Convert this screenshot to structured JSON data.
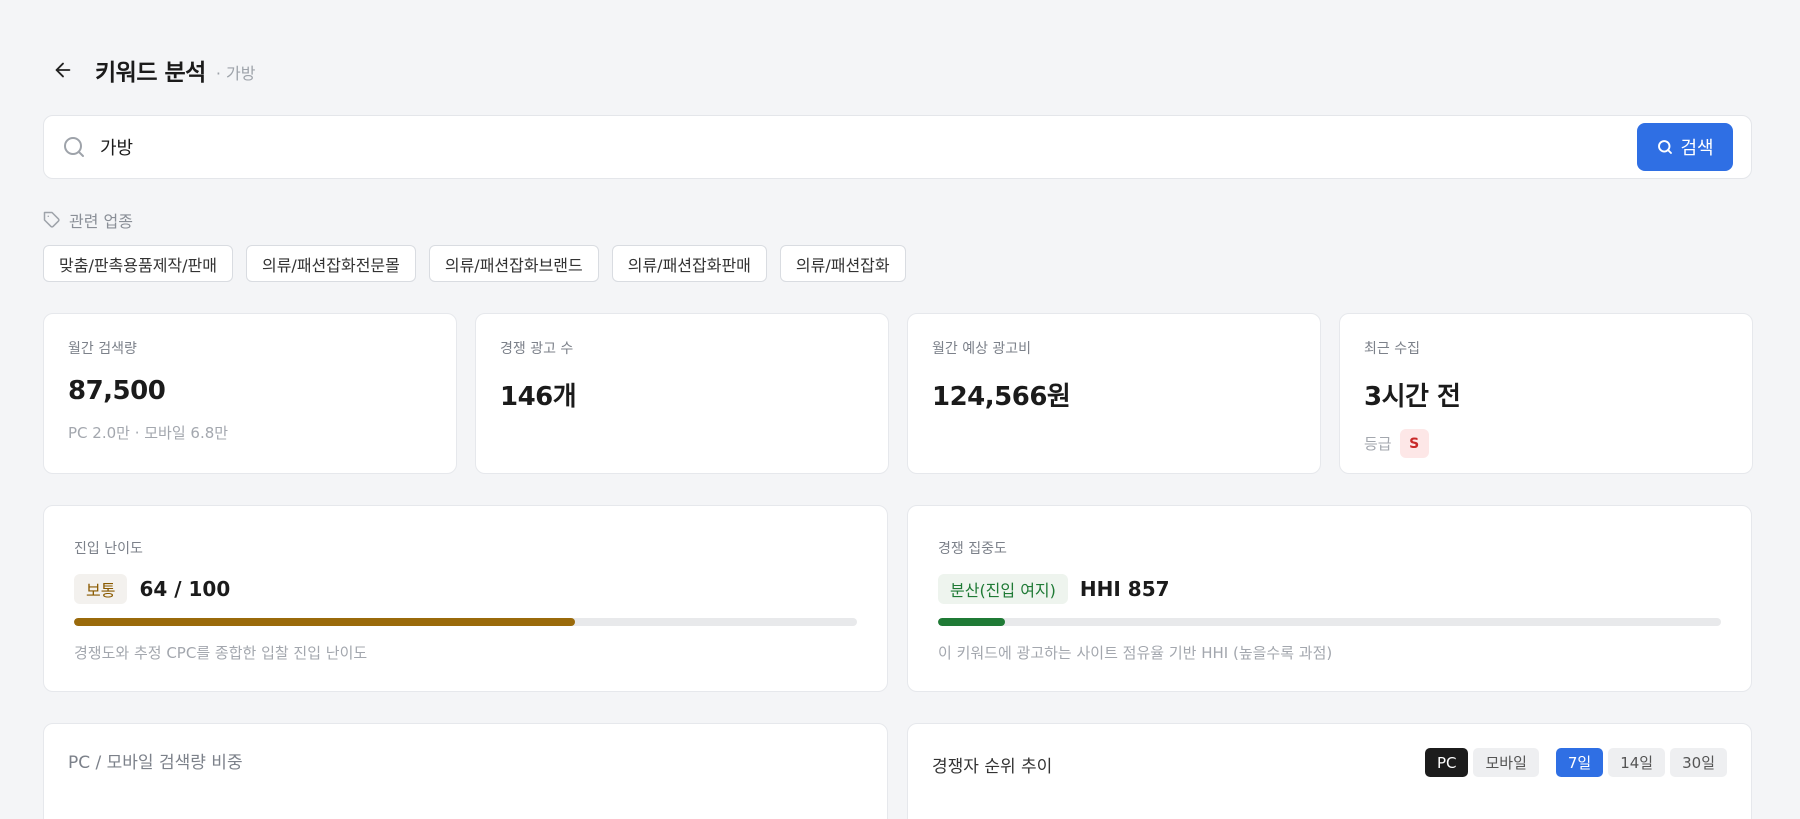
{
  "header": {
    "title": "키워드 분석",
    "subtitle": "· 가방"
  },
  "search": {
    "value": "가방",
    "button_label": "검색"
  },
  "related": {
    "label": "관련 업종",
    "chips": [
      "맞춤/판촉용품제작/판매",
      "의류/패션잡화전문몰",
      "의류/패션잡화브랜드",
      "의류/패션잡화판매",
      "의류/패션잡화"
    ]
  },
  "stats": [
    {
      "label": "월간 검색량",
      "value": "87,500",
      "sub": "PC 2.0만 · 모바일 6.8만"
    },
    {
      "label": "경쟁 광고 수",
      "value": "146개"
    },
    {
      "label": "월간 예상 광고비",
      "value": "124,566원"
    },
    {
      "label": "최근 수집",
      "value": "3시간 전",
      "sub": "등급",
      "grade": "S"
    }
  ],
  "difficulty": {
    "label": "진입 난이도",
    "level": "보통",
    "score": "64 / 100",
    "fraction": 0.64,
    "desc": "경쟁도와 추정 CPC를 종합한 입찰 진입 난이도",
    "badge_bg": "#f3f1ee",
    "badge_color": "#8a5a00",
    "bar_color": "#9a6a0b"
  },
  "concentration": {
    "label": "경쟁 집중도",
    "level": "분산(진입 여지)",
    "score": "HHI 857",
    "fraction": 0.085,
    "desc": "이 키워드에 광고하는 사이트 점유율 기반 HHI (높을수록 과점)",
    "badge_bg": "#eef4ee",
    "badge_color": "#1f7a35",
    "bar_color": "#1f7a35"
  },
  "share_panel": {
    "title": "PC / 모바일 검색량 비중"
  },
  "rank_panel": {
    "title": "경쟁자 순위 추이",
    "device_tabs": [
      "PC",
      "모바일"
    ],
    "period_tabs": [
      "7일",
      "14일",
      "30일"
    ]
  },
  "colors": {
    "accent": "#2f6fe4",
    "grade_bg": "#fde7e7",
    "grade_text": "#c82a2a"
  }
}
